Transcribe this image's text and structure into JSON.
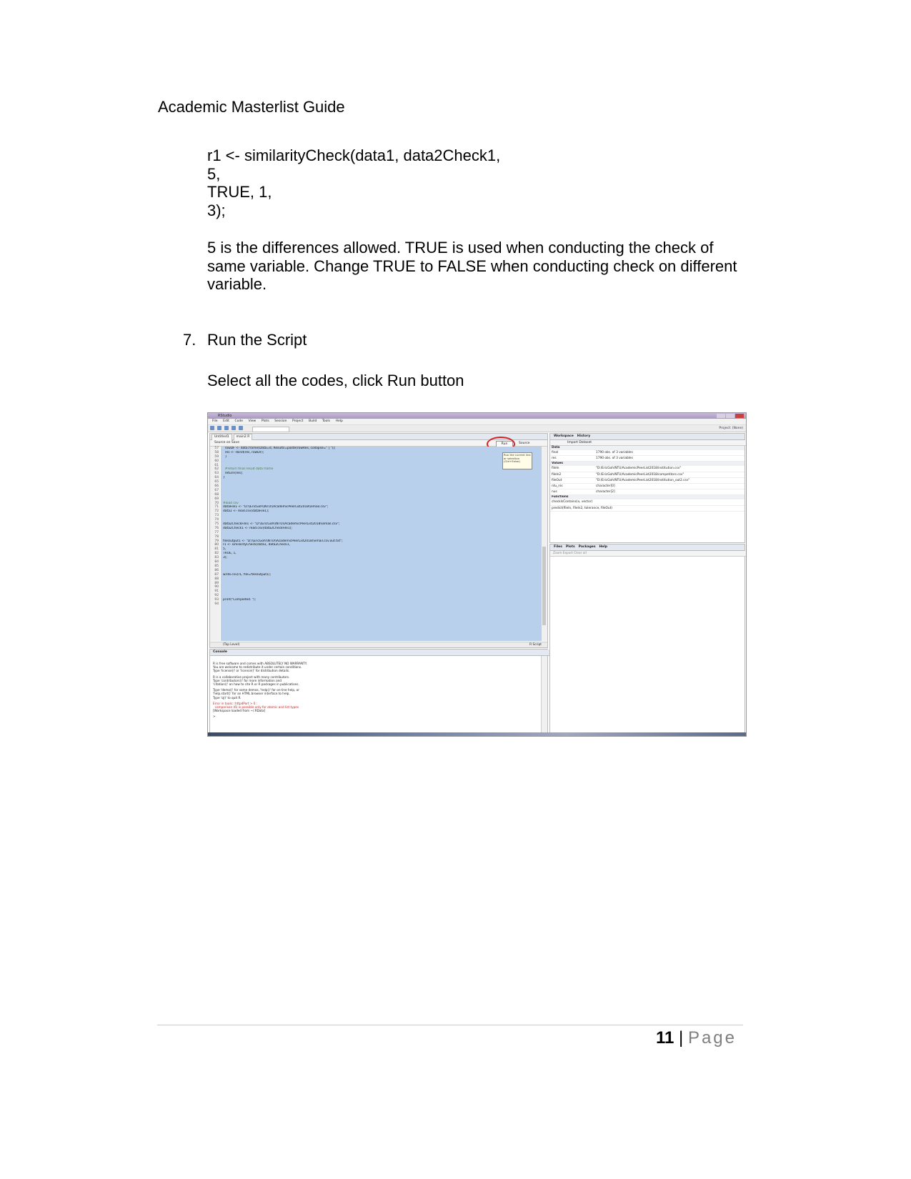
{
  "header": {
    "title": "Academic Masterlist Guide"
  },
  "code_lines": [
    "r1 <- similarityCheck(data1, data2Check1,",
    "5,",
    "TRUE, 1,",
    "3);"
  ],
  "paragraph": "5 is the differences allowed. TRUE is used when conducting the check of same variable. Change TRUE to FALSE when conducting check on different variable.",
  "step": {
    "number": "7.",
    "title": "Run the Script"
  },
  "instruction": "Select all the codes, click Run button",
  "screenshot": {
    "window_title": "RStudio",
    "menu": [
      "File",
      "Edit",
      "Code",
      "View",
      "Plots",
      "Session",
      "Project",
      "Build",
      "Tools",
      "Help"
    ],
    "project": "Project: (None)",
    "tabs": [
      "Untitled1",
      "main2.R"
    ],
    "editor_tools": [
      "Source on Save"
    ],
    "run_label": "Run",
    "source_label": "Source",
    "tooltip": "Run the current line or selection (Ctrl+Enter)",
    "line_numbers": [
      "57",
      "58",
      "59",
      "60",
      "61",
      "62",
      "63",
      "64",
      "65",
      "66",
      "67",
      "68",
      "69",
      "70",
      "71",
      "72",
      "73",
      "74",
      "75",
      "76",
      "77",
      "78",
      "79",
      "80",
      "81",
      "82",
      "83",
      "84",
      "85",
      "86",
      "87",
      "88",
      "89",
      "90",
      "91",
      "92",
      "93",
      "94"
    ],
    "code": [
      "  rowDF <- data.frame(Data=d, Results=paste(rowRes, collapse=\" | \"));",
      "  res <- rbind(res, rowDF);",
      "  }",
      "",
      "",
      "  #return final result data frame",
      "  return(res);",
      "}",
      "",
      "",
      "",
      "",
      "",
      "#load csv",
      "dataFile1 <- \"D:\\\\EricGoh\\\\NTU\\\\AcademicPeerList2018\\\\email.csv\";",
      "data1 <- read.csv(dataFile1);",
      "",
      "",
      "data2CheckFile1 <- \"D:\\\\EricGoh\\\\NTU\\\\AcademicPeerList2018\\\\email.csv\";",
      "data2Check1 <- read.csv(data2CheckFile1);",
      "",
      "",
      "fileOutput1 <- \"D:\\\\EricGoh\\\\NTU\\\\AcademicPeerList2018\\\\email.csv.out.txt\";",
      "r1 <- similarityCheck(data1, data2Check1,",
      "5,",
      "TRUE, 1,",
      "3);",
      "",
      "",
      "",
      "write.csv(r1, file=fileOutput1);",
      "",
      "",
      "",
      "",
      "",
      "print(\"Completed. \");",
      ""
    ],
    "status_left": "(Top Level)",
    "status_right": "R Script",
    "console_title": "Console",
    "console_lines": [
      "R is free software and comes with ABSOLUTELY NO WARRANTY.",
      "You are welcome to redistribute it under certain conditions.",
      "Type 'license()' or 'licence()' for distribution details.",
      "",
      "R is a collaborative project with many contributors.",
      "Type 'contributors()' for more information and",
      "'citation()' on how to cite R or R packages in publications.",
      "",
      "Type 'demo()' for some demos, 'help()' for on-line help, or",
      "'help.start()' for an HTML browser interface to help.",
      "Type 'q()' to quit R.",
      ""
    ],
    "console_errors": [
      "Error in tools:::httpdPort > 0 :",
      "  comparison (6) is possible only for atomic and list types"
    ],
    "console_last": "[Workspace loaded from ~/.RData]",
    "prompt": ">",
    "workspace_tabs": [
      "Workspace",
      "History"
    ],
    "import_label": "Import Dataset",
    "ws_sections": {
      "data": "Data",
      "values": "Values",
      "functions": "Functions"
    },
    "ws_data": [
      {
        "name": "final",
        "value": "1790 obs. of 3 variables"
      },
      {
        "name": "res",
        "value": "1790 obs. of 3 variables"
      }
    ],
    "ws_values": [
      {
        "name": "fileIn",
        "value": "\"D:/EricGoh/NTU/AcademicPeerList2018/institution.csv\""
      },
      {
        "name": "fileIn2",
        "value": "\"D:/EricGoh/NTU/AcademicPeerList2018/competitors.csv\""
      },
      {
        "name": "fileOut",
        "value": "\"D:/EricGoh/NTU/AcademicPeerList2018/institution_out2.csv\""
      },
      {
        "name": "ntu_nis",
        "value": "character[0]"
      },
      {
        "name": "nus",
        "value": "character[2]"
      }
    ],
    "ws_functions": [
      "checkIsContains(x, vector)",
      "predict(fileIn, fileIn2, tolerance, fileOut)"
    ],
    "files_tabs": [
      "Files",
      "Plots",
      "Packages",
      "Help"
    ],
    "files_tools": "Zoom   Export   Clear all"
  },
  "footer": {
    "page_number": "11",
    "separator": "|",
    "page_label": "Page"
  }
}
